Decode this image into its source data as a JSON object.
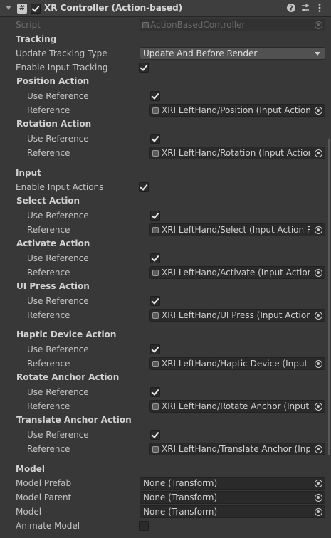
{
  "header": {
    "title": "XR Controller (Action-based)",
    "enabled": true,
    "script_icon_glyph": "#"
  },
  "script_row": {
    "label": "Script",
    "value": "ActionBasedController"
  },
  "tracking": {
    "heading": "Tracking",
    "update_tracking_type_label": "Update Tracking Type",
    "update_tracking_type_value": "Update And Before Render",
    "enable_input_tracking_label": "Enable Input Tracking",
    "position_action": {
      "heading": "Position Action",
      "use_reference_label": "Use Reference",
      "reference_label": "Reference",
      "reference_value": "XRI LeftHand/Position (Input Action Re"
    },
    "rotation_action": {
      "heading": "Rotation Action",
      "use_reference_label": "Use Reference",
      "reference_label": "Reference",
      "reference_value": "XRI LeftHand/Rotation (Input Action R"
    }
  },
  "input": {
    "heading": "Input",
    "enable_input_actions_label": "Enable Input Actions",
    "select_action": {
      "heading": "Select Action",
      "use_reference_label": "Use Reference",
      "reference_label": "Reference",
      "reference_value": "XRI LeftHand/Select (Input Action Ref"
    },
    "activate_action": {
      "heading": "Activate Action",
      "use_reference_label": "Use Reference",
      "reference_label": "Reference",
      "reference_value": "XRI LeftHand/Activate (Input Action R"
    },
    "ui_press_action": {
      "heading": "UI Press Action",
      "use_reference_label": "Use Reference",
      "reference_label": "Reference",
      "reference_value": "XRI LeftHand/UI Press (Input Action Re"
    },
    "haptic_device_action": {
      "heading": "Haptic Device Action",
      "use_reference_label": "Use Reference",
      "reference_label": "Reference",
      "reference_value": "XRI LeftHand/Haptic Device (Input Ac"
    },
    "rotate_anchor_action": {
      "heading": "Rotate Anchor Action",
      "use_reference_label": "Use Reference",
      "reference_label": "Reference",
      "reference_value": "XRI LeftHand/Rotate Anchor (Input Ac"
    },
    "translate_anchor_action": {
      "heading": "Translate Anchor Action",
      "use_reference_label": "Use Reference",
      "reference_label": "Reference",
      "reference_value": "XRI LeftHand/Translate Anchor (Input"
    }
  },
  "model": {
    "heading": "Model",
    "model_prefab_label": "Model Prefab",
    "model_prefab_value": "None (Transform)",
    "model_parent_label": "Model Parent",
    "model_parent_value": "None (Transform)",
    "model_label": "Model",
    "model_value": "None (Transform)",
    "animate_model_label": "Animate Model",
    "animate_model_checked": false
  },
  "colors": {
    "background": "#383838",
    "header_background": "#3e3e3e",
    "field_background": "#2a2a2a",
    "dropdown_background": "#515151",
    "text": "#c4c4c4"
  },
  "icons": {
    "foldout": "chevron-down-icon",
    "script": "script-icon",
    "help": "help-icon",
    "presets": "presets-icon",
    "menu": "kebab-menu-icon",
    "object_picker": "object-picker-icon",
    "asset": "input-action-asset-icon"
  }
}
